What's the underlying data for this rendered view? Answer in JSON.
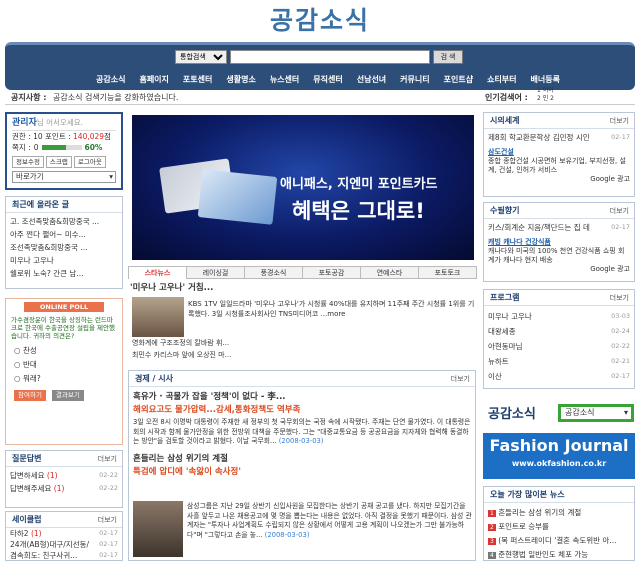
{
  "site": {
    "logo": "공감소식"
  },
  "nav": {
    "search_select": "통합검색",
    "search_button": "검 색",
    "menu": [
      "공감소식",
      "홈페이지",
      "포토센터",
      "생활명소",
      "뉴스센터",
      "뮤직센터",
      "선남선녀",
      "커뮤니티",
      "포인트샵",
      "쇼티부터",
      "배너등록"
    ]
  },
  "noticebar": {
    "label": "공지사항 :",
    "text": "공감소식 검색기능을 강화하였습니다.",
    "right_label": "인기검색어 :",
    "right_item": "1 이어",
    "right_item2": "2 인 2"
  },
  "admin": {
    "title": "관리자",
    "suffix": "님 어서오세요.",
    "level_label": "권한 : 10",
    "point_label": "포인트 : ",
    "point_value": "140,029",
    "point_unit": "점",
    "memo_label": "쪽지 : ",
    "memo_value": "0",
    "progress_text": "60%",
    "progress": 0.6,
    "buttons": [
      "정보수정",
      "스크랩",
      "로그아웃"
    ],
    "goto": "바로가기"
  },
  "recent": {
    "title": "최근에 올라온 글",
    "items": [
      "고. 조선족맞춤&희망중국 ...",
      "아주 쩐다 쩔어~ 미수...",
      "조선족맞춤&희망중국 ...",
      "미우나 고우나",
      "쉘로위 노숙? 간큰 남..."
    ]
  },
  "poll": {
    "title": "ONLINE POLL",
    "question": "가수겸장윤이 한국을 상징하는 런드마크로 한국에 수출공연장 설립을 제안했습니다. 귀하의 의견은?",
    "options": [
      "찬성",
      "반대",
      "뭐래?"
    ],
    "vote": "참여하기",
    "result": "결과보기"
  },
  "qa": {
    "title": "질문답변",
    "more": "더보기",
    "items": [
      {
        "t": "답변하세요",
        "c": "(1)",
        "d": "02-22"
      },
      {
        "t": "답변해주세요",
        "c": "(1)",
        "d": "02-22"
      }
    ]
  },
  "sclub": {
    "title": "세이클럽",
    "more": "더보기",
    "items": [
      {
        "t": "타하2",
        "c": "(1)",
        "d": "02-17"
      },
      {
        "t": "24개(AB형)대구/지선동/",
        "c": "",
        "d": "02-17"
      },
      {
        "t": "겸속희도: 친구사귀...",
        "c": "",
        "d": "02-17"
      }
    ]
  },
  "banner": {
    "line1": "애니패스, 지엔미 포인트카드",
    "line2": "혜택은 그대로!"
  },
  "tabs": [
    "스타뉴스",
    "레이싱걸",
    "풍경소식",
    "포토공감",
    "연예스타",
    "포토토크"
  ],
  "star": {
    "headline": "'미우나 고우나' 거침...",
    "body": "KBS 1TV 일일드라마 '미우나 고우나'가 시청률 40%대를 유지하며 11주째 주간 시청률 1위를 기록했다. 3일 시청률조사회사인 TNS미디어코 ...more",
    "bullets": [
      "영화계에 구조조정의 칼바람 휘...",
      "최민수 카리스마 앞에 오상진 마..."
    ]
  },
  "econ": {
    "title": "경제 / 시사",
    "more": "더보기",
    "headline": "흑유가 · 곡물가 잡을 '정책'이 없다 - 李...",
    "sub": "해외요고도 물가압력...감세,통화정책도 역부족",
    "body": "3일 오전 8시 이명박 대통령이 주재한 새 정부의 첫 국무회의는 국정 속에 시작됐다. 주재는 단연 물가였다. 이 대통령은 회의 시작과 함께 물가안정을 위한 전방위 대책을 주문했다. 그는 \"대중교통요금 등 공공요금을 지자체와 협력해 동결하는 방안\"을 검토할 것이라고 밝혔다. 이날 국무회...",
    "date": "(2008-03-03)"
  },
  "samsung": {
    "headline": "흔들리는 삼성 위기의 계절",
    "sub": "특검에 압디에 '속앓이 속사정'",
    "body": "삼성그룹은 지난 29일 상반기 신입사원을 모집한다는 상반기 공채 공고를 냈다. 하지만 모집기간을 사흘 앞두고 나온 채용공고에 몇 명을 뽑는다는 내용은 없었다. 아직 결정을 못했기 때문이다. 삼성 관계자는 \"투자나 사업계획도 수립되지 않은 상황에서 어떻게 고용 계획이 나오겠는가 그만 불가능하다\"며 \"그렇다고 손을 놓...",
    "date": "(2008-03-03)"
  },
  "right1": {
    "title": "시의세계",
    "more": "더보기",
    "item": "제8회 학교환문학상 김민정 시인",
    "date": "02-17",
    "ad_title": "삼도건설",
    "ad_body": "종합 종합건설 시공면허 보유기업, 부지선정, 설계, 건설, 인허가 서비스",
    "ad_mark": "Google 광고"
  },
  "right2": {
    "title": "수필향기",
    "more": "더보기",
    "item": "키스/회계순 지음/책단드는 집 데",
    "date": "02-17",
    "ad_title": "캐빙 캐나다 건강식품",
    "ad_body": "캐나다와 미국의 100% 천연 건강식품 쇼핑 회계가 캐나다 현지 배송",
    "ad_mark": "Google 광고"
  },
  "program": {
    "title": "프로그램",
    "more": "더보기",
    "items": [
      {
        "t": "미우나 고우나",
        "d": "03-03"
      },
      {
        "t": "대왕세종",
        "d": "02-24"
      },
      {
        "t": "아현동마님",
        "d": "02-22"
      },
      {
        "t": "뉴하트",
        "d": "02-21"
      },
      {
        "t": "이산",
        "d": "02-17"
      }
    ]
  },
  "sitepick": {
    "label": "공감소식",
    "select": "공감소식"
  },
  "fashion": {
    "title": "Fashion Journal",
    "url": "www.okfashion.co.kr"
  },
  "popular": {
    "title": "오늘 가장 많이본 뉴스",
    "items": [
      "흔들리는 삼성 위기의 계절",
      "포인트로 승부를",
      "(복 퍼스트레이디 '결혼 속도위반 아...",
      "준현행법 일반인도 체포 가능"
    ]
  }
}
